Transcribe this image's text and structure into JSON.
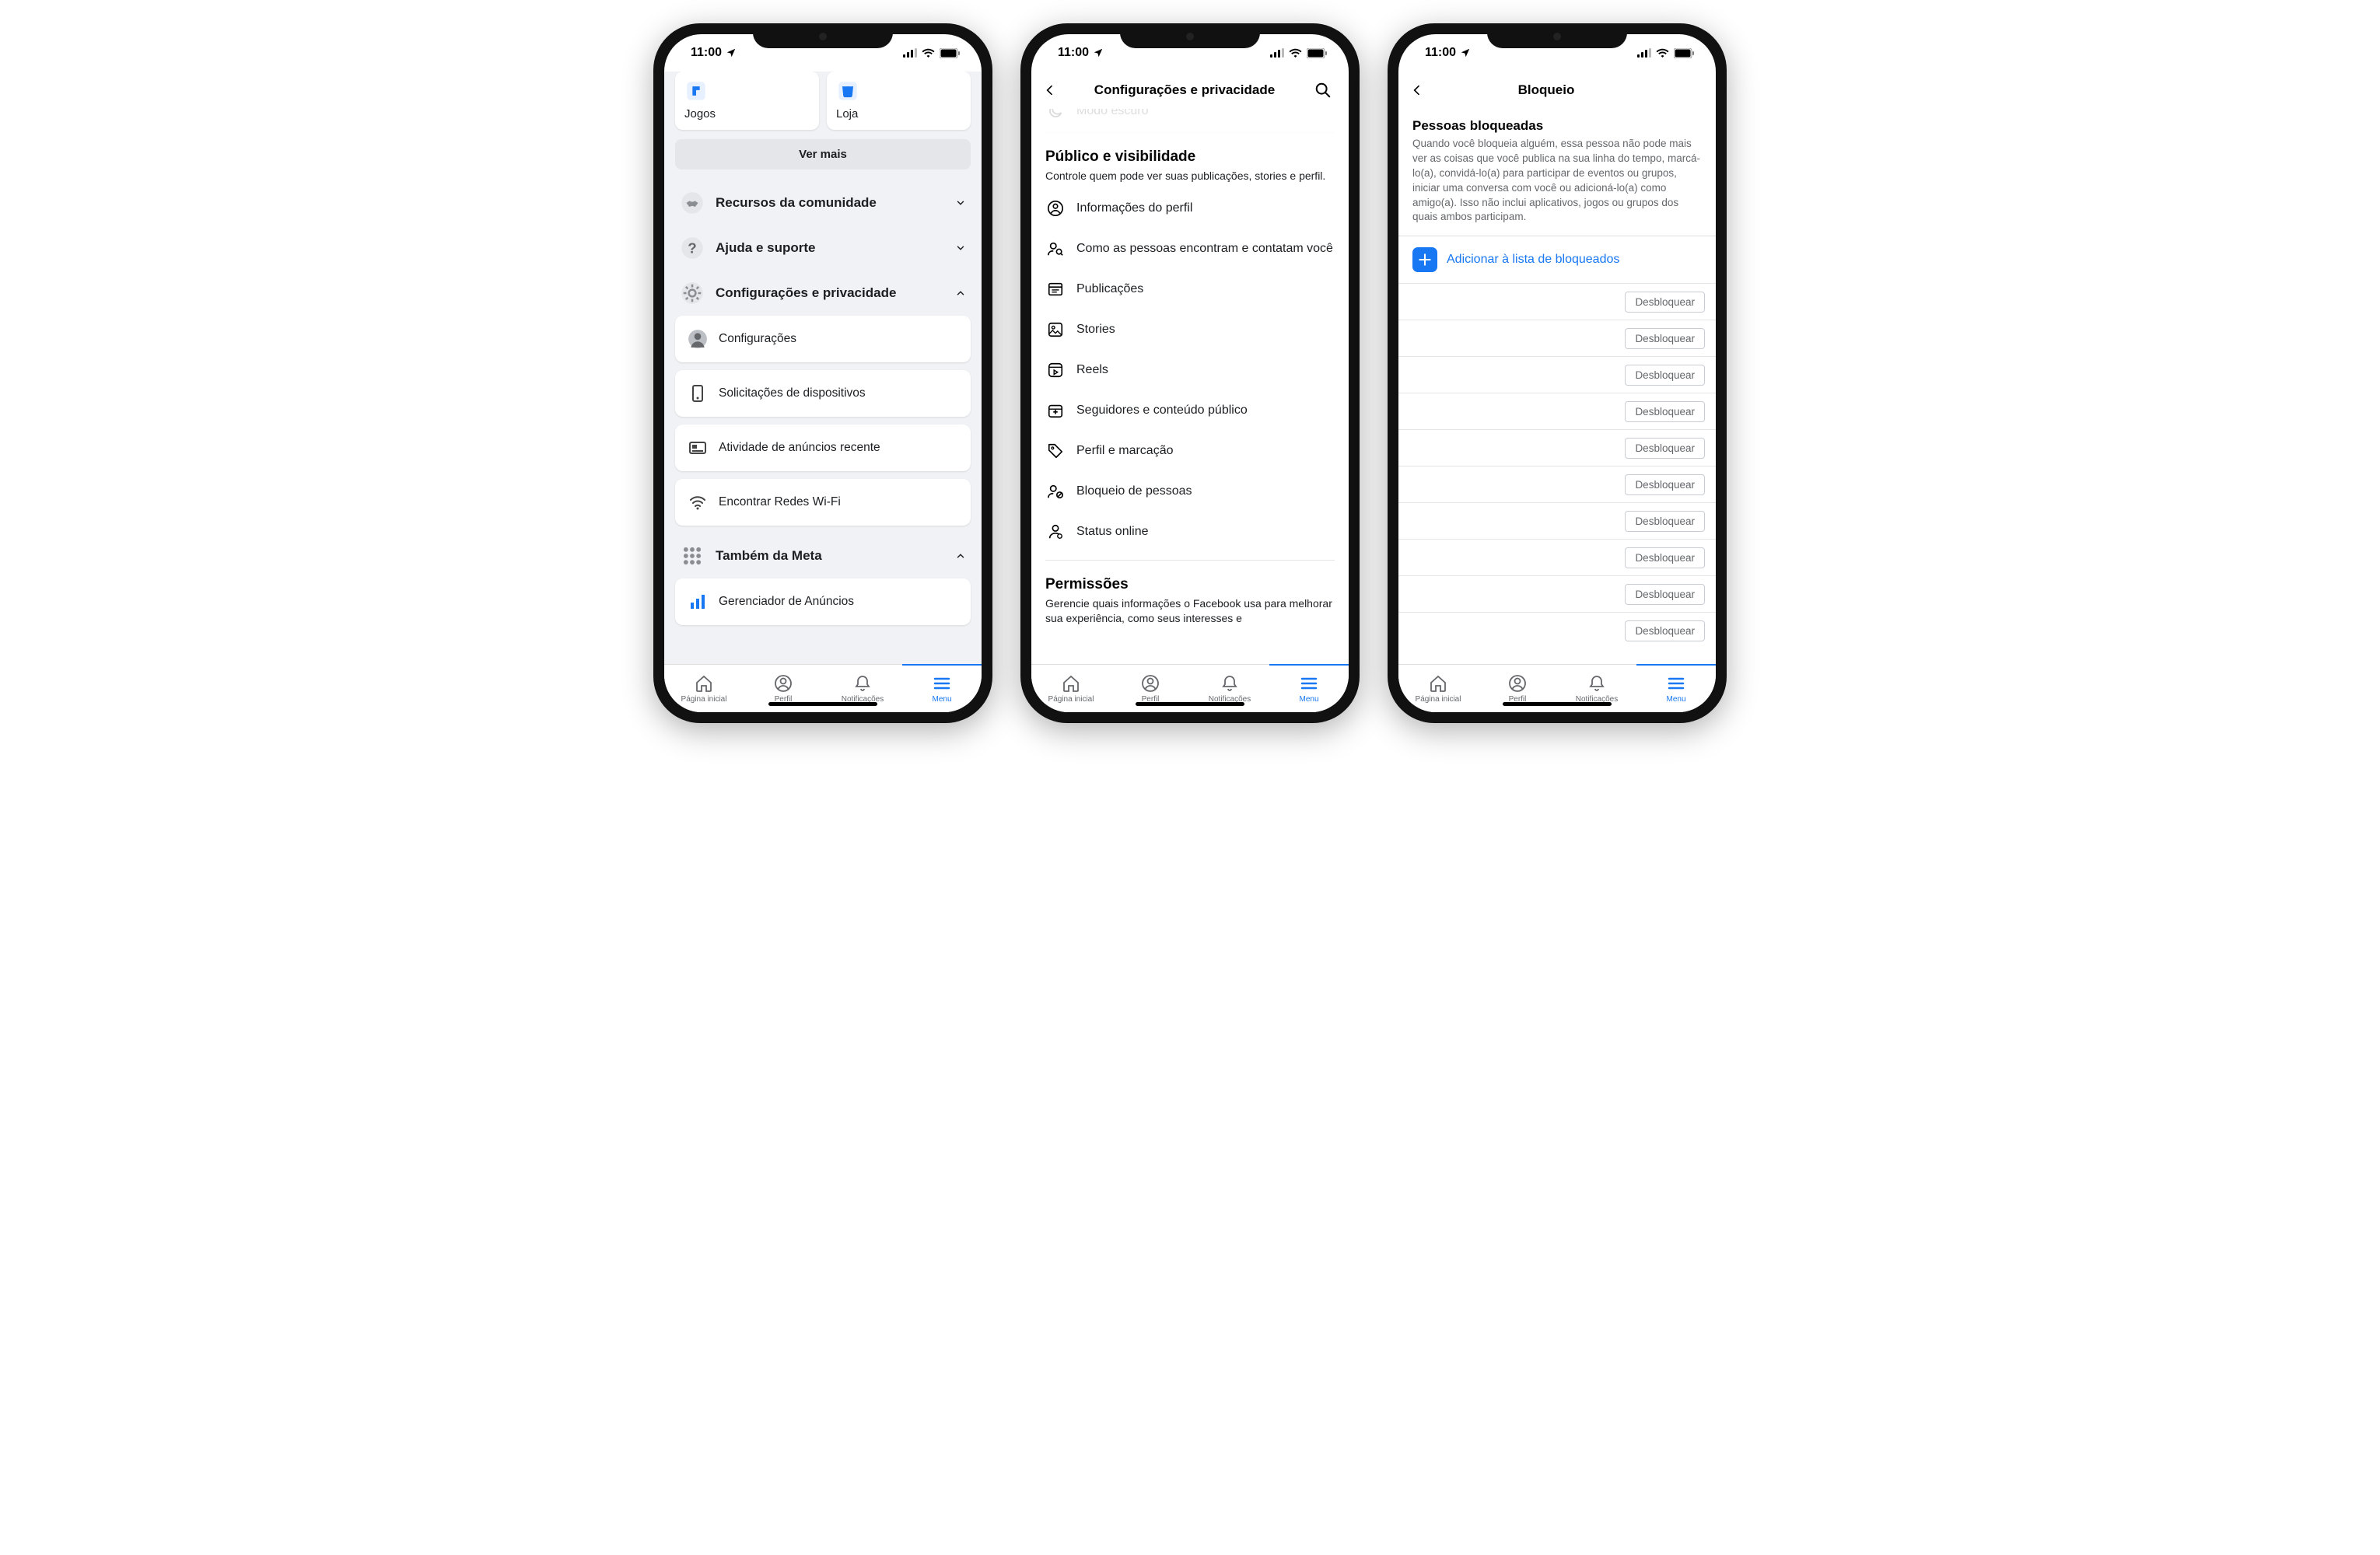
{
  "statusbar": {
    "time": "11:00"
  },
  "tabbar": {
    "items": [
      {
        "label": "Página inicial"
      },
      {
        "label": "Perfil"
      },
      {
        "label": "Notificações"
      },
      {
        "label": "Menu"
      }
    ]
  },
  "screen1": {
    "shortcuts": [
      {
        "label": "Jogos"
      },
      {
        "label": "Loja"
      }
    ],
    "see_more": "Ver mais",
    "accordions": [
      {
        "label": "Recursos da comunidade",
        "expanded": false
      },
      {
        "label": "Ajuda e suporte",
        "expanded": false
      },
      {
        "label": "Configurações e privacidade",
        "expanded": true
      }
    ],
    "settings_items": [
      {
        "label": "Configurações"
      },
      {
        "label": "Solicitações de dispositivos"
      },
      {
        "label": "Atividade de anúncios recente"
      },
      {
        "label": "Encontrar Redes Wi-Fi"
      }
    ],
    "meta_section_label": "Também da Meta",
    "meta_items": [
      {
        "label": "Gerenciador de Anúncios"
      }
    ]
  },
  "screen2": {
    "title": "Configurações e privacidade",
    "truncated_row_label": "Modo escuro",
    "section_audience": {
      "title": "Público e visibilidade",
      "desc": "Controle quem pode ver suas publicações, stories e perfil.",
      "rows": [
        {
          "label": "Informações do perfil"
        },
        {
          "label": "Como as pessoas encontram e contatam você"
        },
        {
          "label": "Publicações"
        },
        {
          "label": "Stories"
        },
        {
          "label": "Reels"
        },
        {
          "label": "Seguidores e conteúdo público"
        },
        {
          "label": "Perfil e marcação"
        },
        {
          "label": "Bloqueio de pessoas"
        },
        {
          "label": "Status online"
        }
      ]
    },
    "section_permissions": {
      "title": "Permissões",
      "desc": "Gerencie quais informações o Facebook usa para melhorar sua experiência, como seus interesses e"
    }
  },
  "screen3": {
    "title": "Bloqueio",
    "section_title": "Pessoas bloqueadas",
    "desc": "Quando você bloqueia alguém, essa pessoa não pode mais ver as coisas que você publica na sua linha do tempo, marcá-lo(a), convidá-lo(a) para participar de eventos ou grupos, iniciar uma conversa com você ou adicioná-lo(a) como amigo(a). Isso não inclui aplicativos, jogos ou grupos dos quais ambos participam.",
    "add_label": "Adicionar à lista de bloqueados",
    "unblock_label": "Desbloquear",
    "blocked_count": 10
  }
}
